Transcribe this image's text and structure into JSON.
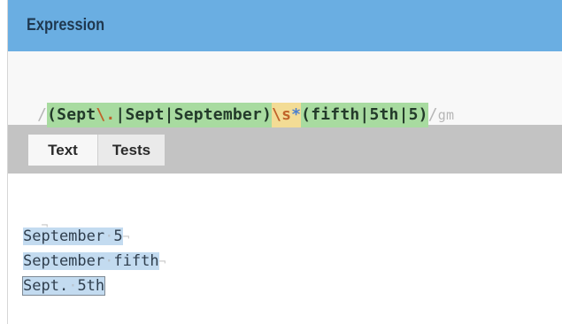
{
  "header": {
    "title": "Expression"
  },
  "expression": {
    "open_delim": "/",
    "tokens": [
      {
        "text": "(",
        "kind": "grp"
      },
      {
        "text": "Sept",
        "kind": "grp"
      },
      {
        "text": "\\.",
        "kind": "esc"
      },
      {
        "text": "|",
        "kind": "pipe"
      },
      {
        "text": "Sept",
        "kind": "grp"
      },
      {
        "text": "|",
        "kind": "pipe"
      },
      {
        "text": "September",
        "kind": "grp"
      },
      {
        "text": ")",
        "kind": "grp"
      },
      {
        "text": "\\s",
        "kind": "esc-y"
      },
      {
        "text": "*",
        "kind": "quant"
      },
      {
        "text": "(",
        "kind": "grp"
      },
      {
        "text": "fifth",
        "kind": "grp"
      },
      {
        "text": "|",
        "kind": "pipe"
      },
      {
        "text": "5th",
        "kind": "grp"
      },
      {
        "text": "|",
        "kind": "pipe"
      },
      {
        "text": "5",
        "kind": "grp"
      },
      {
        "text": ")",
        "kind": "grp"
      }
    ],
    "close_delim": "/",
    "flags": "gm"
  },
  "tabs": [
    {
      "label": "Text",
      "active": true
    },
    {
      "label": "Tests",
      "active": false
    }
  ],
  "text": {
    "empty_line_marker": "¬",
    "lines": [
      {
        "parts": [
          "September",
          "5"
        ]
      },
      {
        "parts": [
          "September",
          "fifth"
        ]
      },
      {
        "parts": [
          "Sept.",
          "5th"
        ]
      }
    ],
    "whitespace_marker": "·",
    "eol_marker": "¬"
  },
  "colors": {
    "header_bg": "#6aaee2",
    "group_bg": "#a8dba0",
    "quantifier_bg": "#f3dc95",
    "match_bg": "#c3dbf0",
    "tabbar_bg": "#c3c3c3"
  }
}
